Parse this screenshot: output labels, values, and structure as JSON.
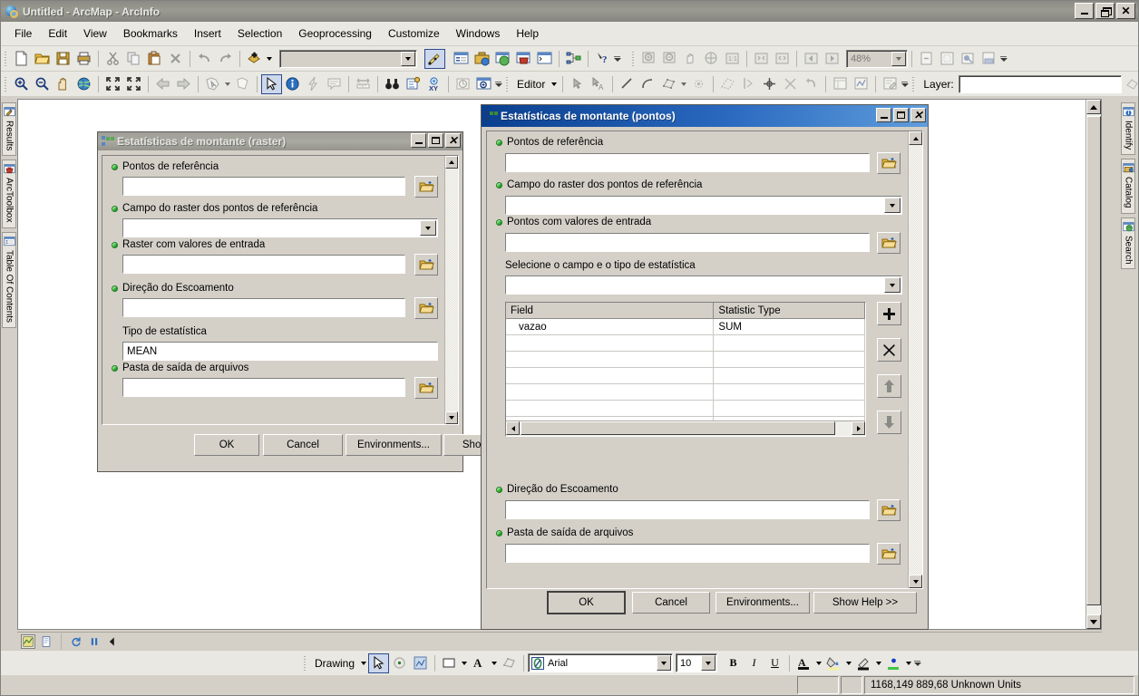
{
  "window": {
    "title": "Untitled - ArcMap - ArcInfo",
    "app_icon": "arcmap-globe-icon",
    "controls": {
      "minimize": "_",
      "restore": "restore",
      "close": "X"
    }
  },
  "menubar": {
    "items": [
      {
        "label": "File"
      },
      {
        "label": "Edit"
      },
      {
        "label": "View"
      },
      {
        "label": "Bookmarks"
      },
      {
        "label": "Insert"
      },
      {
        "label": "Selection"
      },
      {
        "label": "Geoprocessing"
      },
      {
        "label": "Customize"
      },
      {
        "label": "Windows"
      },
      {
        "label": "Help"
      }
    ]
  },
  "toolbars": {
    "standard": {
      "zoom_value": "48%",
      "scale_value": "",
      "icons": [
        "new-document-icon",
        "open-folder-icon",
        "save-icon",
        "print-icon",
        "cut-icon",
        "copy-icon",
        "paste-icon",
        "delete-icon",
        "undo-icon",
        "redo-icon",
        "add-data-icon"
      ],
      "icons_after": [
        "editor-toolbar-icon",
        "table-of-contents-icon",
        "catalog-icon",
        "search-icon",
        "arctoolbox-icon",
        "python-window-icon",
        "model-builder-icon",
        "whats-this-icon"
      ]
    },
    "tools": {
      "icons": [
        "zoom-in-icon",
        "zoom-out-icon",
        "pan-icon",
        "full-extent-icon",
        "fixed-zoom-in-icon",
        "fixed-zoom-out-icon",
        "go-back-extent-icon",
        "go-forward-extent-icon",
        "select-features-icon",
        "clear-selection-icon",
        "select-elements-icon",
        "identify-icon",
        "hyperlink-icon",
        "html-popup-icon",
        "measure-icon",
        "find-icon",
        "find-route-icon",
        "go-to-xy-icon",
        "time-slider-icon",
        "create-viewer-window-icon"
      ]
    },
    "editor": {
      "label": "Editor",
      "icons": [
        "edit-tool-icon",
        "edit-annotation-icon",
        "straight-segment-icon",
        "arc-segment-icon",
        "midpoint-icon",
        "trace-icon",
        "construct-points-icon",
        "split-tool-icon",
        "rotate-icon",
        "attributes-icon",
        "sketch-properties-icon",
        "edit-vertices-icon"
      ]
    },
    "layer": {
      "label": "Layer:",
      "value": ""
    }
  },
  "dock_left": {
    "items": [
      {
        "label": "Results",
        "icon": "results-hammer-icon"
      },
      {
        "label": "ArcToolbox",
        "icon": "arctoolbox-red-icon"
      },
      {
        "label": "Table Of Contents",
        "icon": "table-of-contents-icon"
      }
    ]
  },
  "dock_right": {
    "items": [
      {
        "label": "Identify",
        "icon": "identify-info-icon"
      },
      {
        "label": "Catalog",
        "icon": "catalog-icon"
      },
      {
        "label": "Search",
        "icon": "search-globe-icon"
      }
    ]
  },
  "dialog_raster": {
    "title": "Estatísticas de montante (raster)",
    "icon": "geoprocessing-tool-icon",
    "controls": {
      "minimize": "_",
      "maximize": "maximize",
      "close": "X"
    },
    "fields": [
      {
        "label": "Pontos de referência",
        "required": true,
        "type": "browse",
        "value": ""
      },
      {
        "label": "Campo do raster dos pontos de referência",
        "required": true,
        "type": "dropdown",
        "value": ""
      },
      {
        "label": "Raster com valores de entrada",
        "required": true,
        "type": "browse",
        "value": ""
      },
      {
        "label": "Direção do Escoamento",
        "required": true,
        "type": "browse",
        "value": ""
      },
      {
        "label": "Tipo de estatística",
        "required": false,
        "type": "text",
        "value": "MEAN"
      },
      {
        "label": "Pasta de saída de arquivos",
        "required": true,
        "type": "browse",
        "value": ""
      }
    ],
    "buttons": [
      {
        "label": "OK"
      },
      {
        "label": "Cancel"
      },
      {
        "label": "Environments..."
      },
      {
        "label": "Show Help >>"
      }
    ]
  },
  "dialog_pontos": {
    "title": "Estatísticas de montante (pontos)",
    "icon": "geoprocessing-tool-icon",
    "controls": {
      "minimize": "_",
      "maximize": "maximize",
      "close": "X"
    },
    "fields_top": [
      {
        "label": "Pontos de referência",
        "required": true,
        "type": "browse",
        "value": ""
      },
      {
        "label": "Campo do raster dos pontos de referência",
        "required": true,
        "type": "dropdown",
        "value": ""
      },
      {
        "label": "Pontos com valores de entrada",
        "required": true,
        "type": "browse",
        "value": ""
      },
      {
        "label": "Selecione o campo e o tipo de estatística",
        "required": false,
        "type": "dropdown",
        "value": ""
      }
    ],
    "table": {
      "columns": [
        "Field",
        "Statistic Type"
      ],
      "rows": [
        {
          "field": "vazao",
          "statistic_type": "SUM"
        }
      ],
      "empty_rows": 7,
      "side_buttons": [
        {
          "name": "add",
          "glyph": "+"
        },
        {
          "name": "remove",
          "glyph": "×"
        },
        {
          "name": "move-up",
          "glyph": "↑"
        },
        {
          "name": "move-down",
          "glyph": "↓"
        }
      ]
    },
    "fields_bottom": [
      {
        "label": "Direção do Escoamento",
        "required": true,
        "type": "browse",
        "value": ""
      },
      {
        "label": "Pasta de saída de arquivos",
        "required": true,
        "type": "browse",
        "value": ""
      }
    ],
    "buttons": [
      {
        "label": "OK"
      },
      {
        "label": "Cancel"
      },
      {
        "label": "Environments..."
      },
      {
        "label": "Show Help >>"
      }
    ]
  },
  "draw_toolbar": {
    "label": "Drawing",
    "font_name": "Arial",
    "font_size": "10",
    "bold": "B",
    "italic": "I",
    "underline": "U",
    "icons": [
      "select-elements-icon",
      "rotate-element-icon",
      "draw-shape-icon",
      "fill-color-icon",
      "font-color-icon",
      "new-text-icon",
      "nudge-icon",
      "text-color-icon",
      "fill-swatch-icon",
      "line-color-icon",
      "marker-color-icon"
    ]
  },
  "view_toolbar": {
    "icons": [
      "data-view-icon",
      "layout-view-icon",
      "refresh-icon",
      "pause-icon",
      "back-icon"
    ]
  },
  "statusbar": {
    "coordinates": "1168,149  889,68 Unknown Units"
  },
  "colors": {
    "chrome": "#d4d0c8",
    "toolbar": "#e9e8e2",
    "title_inactive": "#9a9a92",
    "title_active_start": "#0a3f8f",
    "title_active_end": "#5f9ddc",
    "required_dot": "#36c436",
    "selected_tool_border": "#2c4b8e"
  }
}
